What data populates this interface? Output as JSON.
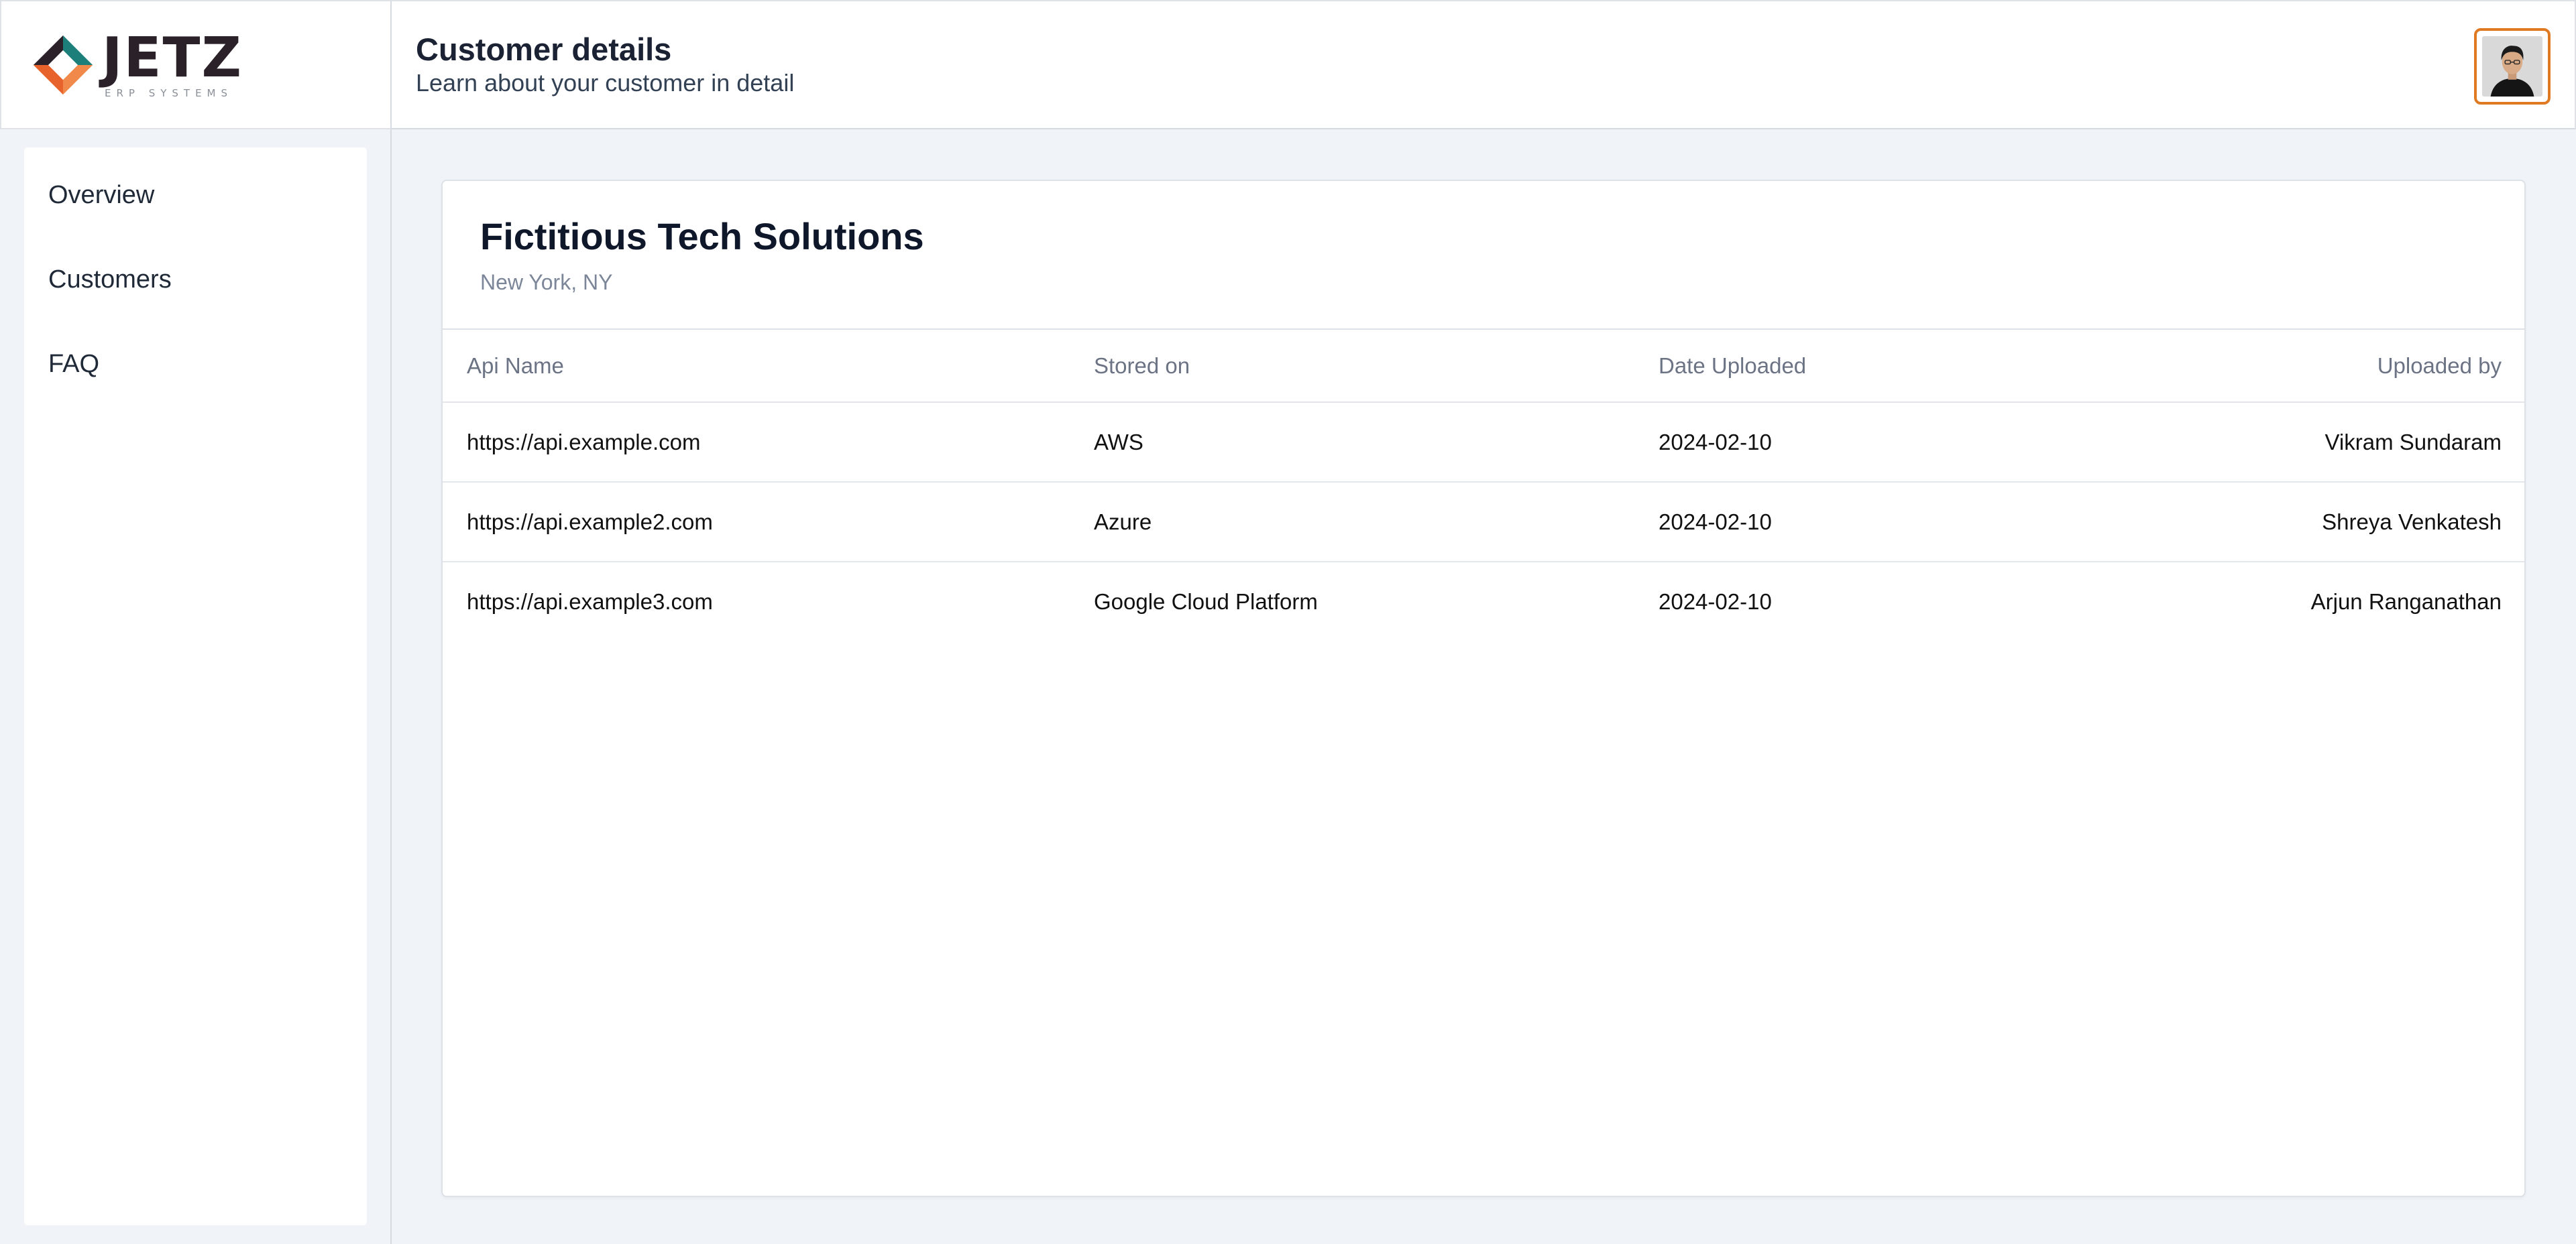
{
  "brand": {
    "name": "JETZ",
    "tagline": "ERP SYSTEMS",
    "colors": {
      "teal": "#1d7f7a",
      "orange": "#e8632b",
      "dark": "#2b2129"
    }
  },
  "header": {
    "title": "Customer details",
    "subtitle": "Learn about your customer in detail",
    "avatar_border_color": "#e07a22"
  },
  "sidebar": {
    "items": [
      {
        "label": "Overview"
      },
      {
        "label": "Customers"
      },
      {
        "label": "FAQ"
      }
    ]
  },
  "customer": {
    "name": "Fictitious Tech Solutions",
    "location": "New York, NY"
  },
  "table": {
    "headers": [
      "Api Name",
      "Stored on",
      "Date Uploaded",
      "Uploaded by"
    ],
    "rows": [
      [
        "https://api.example.com",
        "AWS",
        "2024-02-10",
        "Vikram Sundaram"
      ],
      [
        "https://api.example2.com",
        "Azure",
        "2024-02-10",
        "Shreya Venkatesh"
      ],
      [
        "https://api.example3.com",
        "Google Cloud Platform",
        "2024-02-10",
        "Arjun Ranganathan"
      ]
    ]
  }
}
